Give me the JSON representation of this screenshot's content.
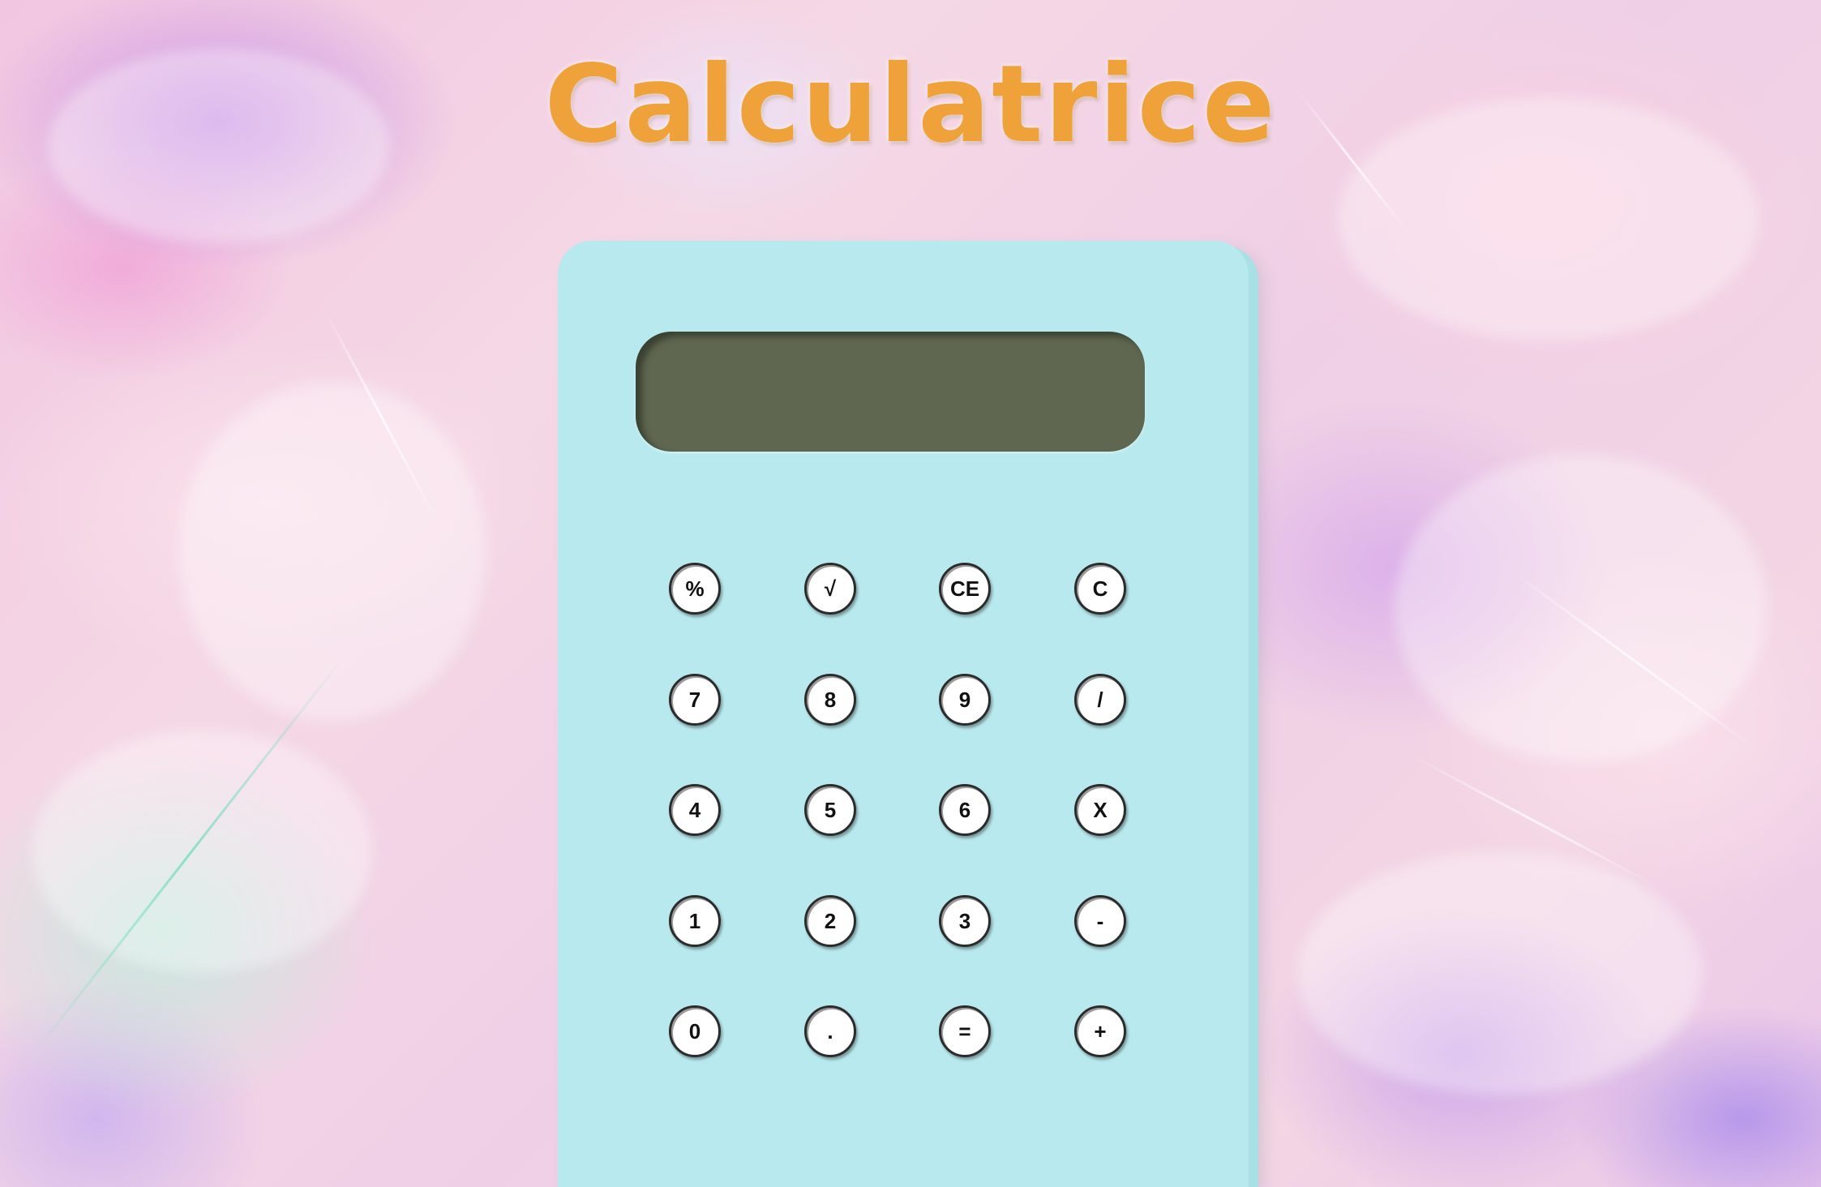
{
  "page": {
    "title": "Calculatrice"
  },
  "calculator": {
    "display_value": "",
    "colors": {
      "body": "#b8e9ee",
      "display": "#5f6751",
      "title": "#f0a23a",
      "key": "#ffffff",
      "key_border": "#2b2b2b"
    }
  },
  "keys": [
    {
      "label": "%",
      "name": "percent-key"
    },
    {
      "label": "√",
      "name": "square-root-key"
    },
    {
      "label": "CE",
      "name": "clear-entry-key"
    },
    {
      "label": "C",
      "name": "clear-key"
    },
    {
      "label": "7",
      "name": "digit-7-key"
    },
    {
      "label": "8",
      "name": "digit-8-key"
    },
    {
      "label": "9",
      "name": "digit-9-key"
    },
    {
      "label": "/",
      "name": "divide-key"
    },
    {
      "label": "4",
      "name": "digit-4-key"
    },
    {
      "label": "5",
      "name": "digit-5-key"
    },
    {
      "label": "6",
      "name": "digit-6-key"
    },
    {
      "label": "X",
      "name": "multiply-key"
    },
    {
      "label": "1",
      "name": "digit-1-key"
    },
    {
      "label": "2",
      "name": "digit-2-key"
    },
    {
      "label": "3",
      "name": "digit-3-key"
    },
    {
      "label": "-",
      "name": "subtract-key"
    },
    {
      "label": "0",
      "name": "digit-0-key"
    },
    {
      "label": ".",
      "name": "decimal-point-key"
    },
    {
      "label": "=",
      "name": "equals-key"
    },
    {
      "label": "+",
      "name": "add-key"
    }
  ]
}
